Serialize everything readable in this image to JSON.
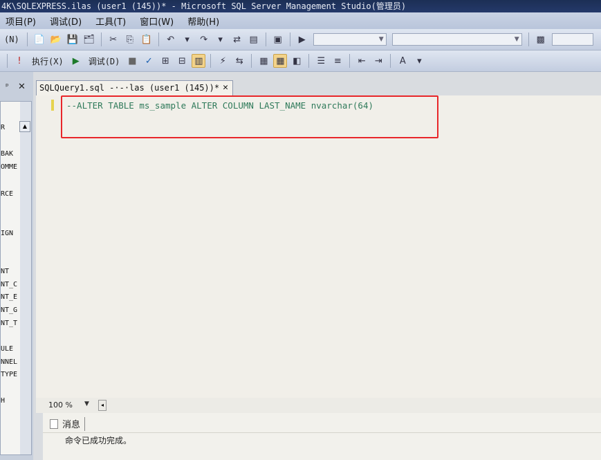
{
  "window": {
    "title": "4K\\SQLEXPRESS.ilas (user1 (145))* - Microsoft SQL Server Management Studio(管理员)"
  },
  "menu": {
    "items": [
      "项目(P)",
      "调试(D)",
      "工具(T)",
      "窗口(W)",
      "帮助(H)"
    ]
  },
  "toolbar": {
    "new_query_label": "(N)",
    "execute_label": "执行(X)",
    "debug_label": "调试(D)"
  },
  "left_panel": {
    "items": [
      "R",
      "BAK",
      "OMME",
      "RCE",
      "IGN",
      "NT",
      "NT_C",
      "NT_E",
      "NT_G",
      "NT_T",
      "ULE",
      "NNEL",
      "TYPE",
      "H"
    ]
  },
  "editor": {
    "tab_title": "SQLQuery1.sql -·-·las (user1 (145))*",
    "code": "--ALTER TABLE ms_sample ALTER COLUMN LAST_NAME nvarchar(64)",
    "zoom": "100 %"
  },
  "messages": {
    "tab_label": "消息",
    "text": "命令已成功完成。"
  }
}
